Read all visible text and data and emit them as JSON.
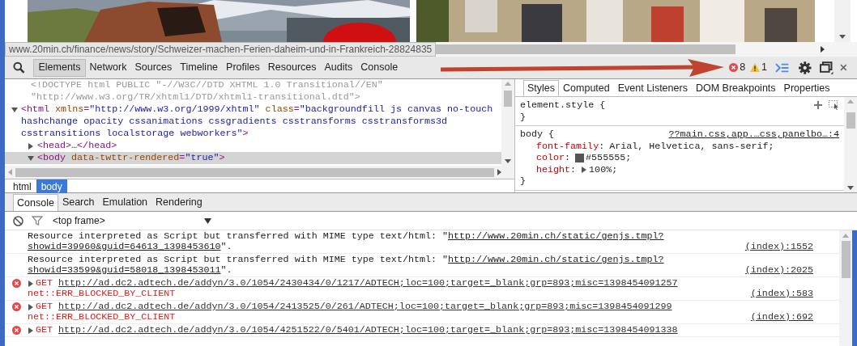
{
  "status_url": "www.20min.ch/finance/news/story/Schweizer-machen-Ferien-daheim-und-in-Frankreich-28824835",
  "panel_tabs": [
    {
      "label": "Elements",
      "selected": true
    },
    {
      "label": "Network",
      "selected": false
    },
    {
      "label": "Sources",
      "selected": false
    },
    {
      "label": "Timeline",
      "selected": false
    },
    {
      "label": "Profiles",
      "selected": false
    },
    {
      "label": "Resources",
      "selected": false
    },
    {
      "label": "Audits",
      "selected": false
    },
    {
      "label": "Console",
      "selected": false
    }
  ],
  "error_count": "8",
  "warning_count": "1",
  "dom_nodes": [
    {
      "kind": "doctype",
      "selected": false,
      "segments": [
        {
          "kind": "doctype",
          "s": "<!DOCTYPE html PUBLIC \"-//W3C//DTD XHTML 1.0 Transitional//EN\" \"http://www.w3.org/TR/xhtml1/DTD/xhtml1-transitional.dtd\">"
        }
      ]
    },
    {
      "kind": "element",
      "expanded": true,
      "selected": false,
      "segments": [
        {
          "kind": "tag",
          "s": "<html"
        },
        {
          "kind": "attr",
          "s": " xmlns"
        },
        {
          "kind": "tag",
          "s": "="
        },
        {
          "kind": "value",
          "s": "\"http://www.w3.org/1999/xhtml\""
        },
        {
          "kind": "attr",
          "s": " class"
        },
        {
          "kind": "tag",
          "s": "="
        },
        {
          "kind": "value",
          "s": "\"backgroundfill js canvas no-touch hashchange opacity cssanimations cssgradients csstransforms csstransforms3d csstransitions localstorage webworkers\""
        },
        {
          "kind": "tag",
          "s": ">"
        }
      ]
    },
    {
      "kind": "child",
      "expanded": false,
      "selected": false,
      "segments": [
        {
          "kind": "tag",
          "s": "<head>"
        },
        {
          "kind": "plain",
          "s": "…"
        },
        {
          "kind": "tag",
          "s": "</head>"
        }
      ]
    },
    {
      "kind": "child",
      "expanded": true,
      "selected": true,
      "segments": [
        {
          "kind": "tag",
          "s": "<body"
        },
        {
          "kind": "attr",
          "s": " data-twttr-rendered"
        },
        {
          "kind": "tag",
          "s": "="
        },
        {
          "kind": "value",
          "s": "\"true\""
        },
        {
          "kind": "tag",
          "s": ">"
        }
      ]
    }
  ],
  "breadcrumbs": [
    {
      "label": "html",
      "selected": false
    },
    {
      "label": "body",
      "selected": true
    }
  ],
  "style_tabs": [
    {
      "label": "Styles",
      "selected": true
    },
    {
      "label": "Computed",
      "selected": false
    },
    {
      "label": "Event Listeners",
      "selected": false
    },
    {
      "label": "DOM Breakpoints",
      "selected": false
    },
    {
      "label": "Properties",
      "selected": false
    }
  ],
  "style_rules": [
    {
      "selector": "element.style {",
      "close": "}"
    },
    {
      "selector": "body {",
      "source": "??main.css,app.…css,panelbo…:4",
      "close": "}",
      "properties": [
        {
          "name": "font-family",
          "colon": ":",
          "value": "Arial, Helvetica, sans-serif;"
        },
        {
          "name": "color",
          "colon": ":",
          "color": "#555555",
          "value": "#555555;"
        },
        {
          "name": "height",
          "colon": ":",
          "expandable": true,
          "value": "100%;"
        }
      ]
    }
  ],
  "drawer_tabs": [
    {
      "label": "Console",
      "selected": true
    },
    {
      "label": "Search",
      "selected": false
    },
    {
      "label": "Emulation",
      "selected": false
    },
    {
      "label": "Rendering",
      "selected": false
    }
  ],
  "frame_select": {
    "value": "<top frame>"
  },
  "messages": [
    {
      "kind": "log",
      "text": "Resource interpreted as Script but transferred with MIME type text/html: \"",
      "link_lines": [
        "http://www.20min.ch/static/genjs.tmpl?",
        "showid=39960&guid=64613_1398453610"
      ],
      "after": "\".",
      "source": "(index):1552"
    },
    {
      "kind": "log",
      "text": "Resource interpreted as Script but transferred with MIME type text/html: \"",
      "link_lines": [
        "http://www.20min.ch/static/genjs.tmpl?",
        "showid=33599&guid=58018_1398453011"
      ],
      "after": "\".",
      "source": "(index):2025"
    },
    {
      "kind": "error",
      "method": "GET",
      "link": "http://ad.dc2.adtech.de/addyn/3.0/1054/2430434/0/1217/ADTECH;loc=100;target=_blank;grp=893;misc=1398454091257",
      "detail": "net::ERR_BLOCKED_BY_CLIENT",
      "source": "(index):583"
    },
    {
      "kind": "error",
      "method": "GET",
      "link": "http://ad.dc2.adtech.de/addyn/3.0/1054/2413525/0/261/ADTECH;loc=100;target=_blank;grp=893;misc=1398454091299",
      "detail": "net::ERR_BLOCKED_BY_CLIENT",
      "source": "(index):692"
    },
    {
      "kind": "error",
      "method": "GET",
      "link": "http://ad.dc2.adtech.de/addyn/3.0/1054/4251522/0/5401/ADTECH;loc=100;target=_blank;grp=893;misc=1398454091338"
    }
  ]
}
